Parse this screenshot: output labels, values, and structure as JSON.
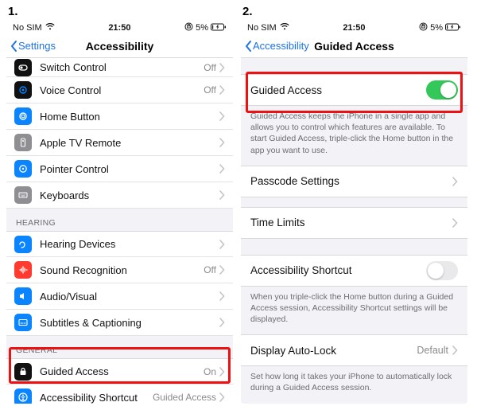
{
  "labels": {
    "shot1": "1.",
    "shot2": "2."
  },
  "status": {
    "carrier": "No SIM",
    "time": "21:50",
    "battery": "5%"
  },
  "left": {
    "back": "Settings",
    "title": "Accessibility",
    "rows": {
      "switch_control": {
        "label": "Switch Control",
        "detail": "Off"
      },
      "voice_control": {
        "label": "Voice Control",
        "detail": "Off"
      },
      "home_button": {
        "label": "Home Button",
        "detail": ""
      },
      "apple_tv_remote": {
        "label": "Apple TV Remote",
        "detail": ""
      },
      "pointer_control": {
        "label": "Pointer Control",
        "detail": ""
      },
      "keyboards": {
        "label": "Keyboards",
        "detail": ""
      },
      "hearing_devices": {
        "label": "Hearing Devices",
        "detail": ""
      },
      "sound_recognition": {
        "label": "Sound Recognition",
        "detail": "Off"
      },
      "audio_visual": {
        "label": "Audio/Visual",
        "detail": ""
      },
      "subtitles": {
        "label": "Subtitles & Captioning",
        "detail": ""
      },
      "guided_access": {
        "label": "Guided Access",
        "detail": "On"
      },
      "accessibility_shortcut": {
        "label": "Accessibility Shortcut",
        "detail": "Guided Access"
      }
    },
    "sections": {
      "hearing": "HEARING",
      "general": "GENERAL"
    }
  },
  "right": {
    "back": "Accessibility",
    "title": "Guided Access",
    "rows": {
      "guided_access": {
        "label": "Guided Access",
        "footer": "Guided Access keeps the iPhone in a single app and allows you to control which features are available. To start Guided Access, triple-click the Home button in the app you want to use."
      },
      "passcode": {
        "label": "Passcode Settings"
      },
      "time_limits": {
        "label": "Time Limits"
      },
      "accessibility_shortcut": {
        "label": "Accessibility Shortcut",
        "footer": "When you triple-click the Home button during a Guided Access session, Accessibility Shortcut settings will be displayed."
      },
      "display_auto_lock": {
        "label": "Display Auto-Lock",
        "detail": "Default",
        "footer": "Set how long it takes your iPhone to automatically lock during a Guided Access session."
      }
    }
  }
}
